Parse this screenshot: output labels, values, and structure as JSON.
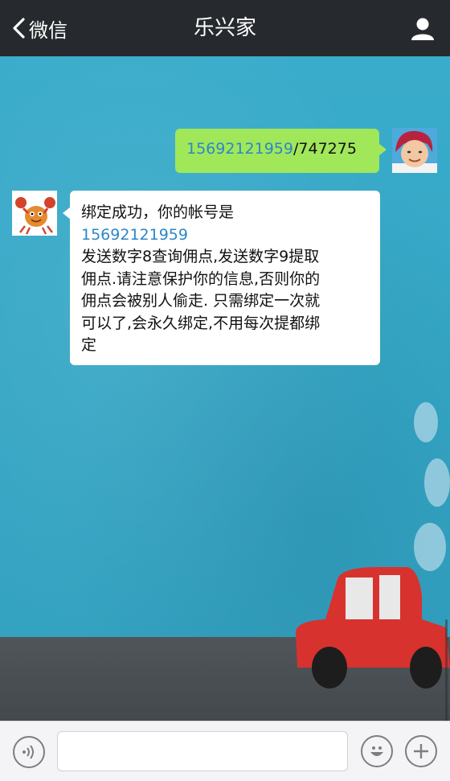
{
  "navbar": {
    "back_label": "微信",
    "title": "乐兴家"
  },
  "messages": [
    {
      "direction": "outgoing",
      "link_text": "15692121959",
      "rest_text": "/747275"
    },
    {
      "direction": "incoming",
      "line1": "绑定成功，你的帐号是",
      "link_text": "15692121959",
      "body_lines": [
        "发送数字8查询佣点,发送数字9提取",
        "佣点.请注意保护你的信息,否则你的",
        "佣点会被别人偷走. 只需绑定一次就",
        "可以了,会永久绑定,不用每次提都绑",
        "定"
      ]
    }
  ],
  "input": {
    "value": "",
    "placeholder": ""
  },
  "colors": {
    "navbar": "#262a2e",
    "outgoing_bubble": "#a0e75a",
    "incoming_bubble": "#ffffff",
    "link": "#2d87c8",
    "background": "#36a9c6"
  },
  "icons": {
    "back": "chevron-left-icon",
    "profile": "user-icon",
    "voice": "voice-icon",
    "emoji": "emoji-icon",
    "more": "plus-icon"
  }
}
